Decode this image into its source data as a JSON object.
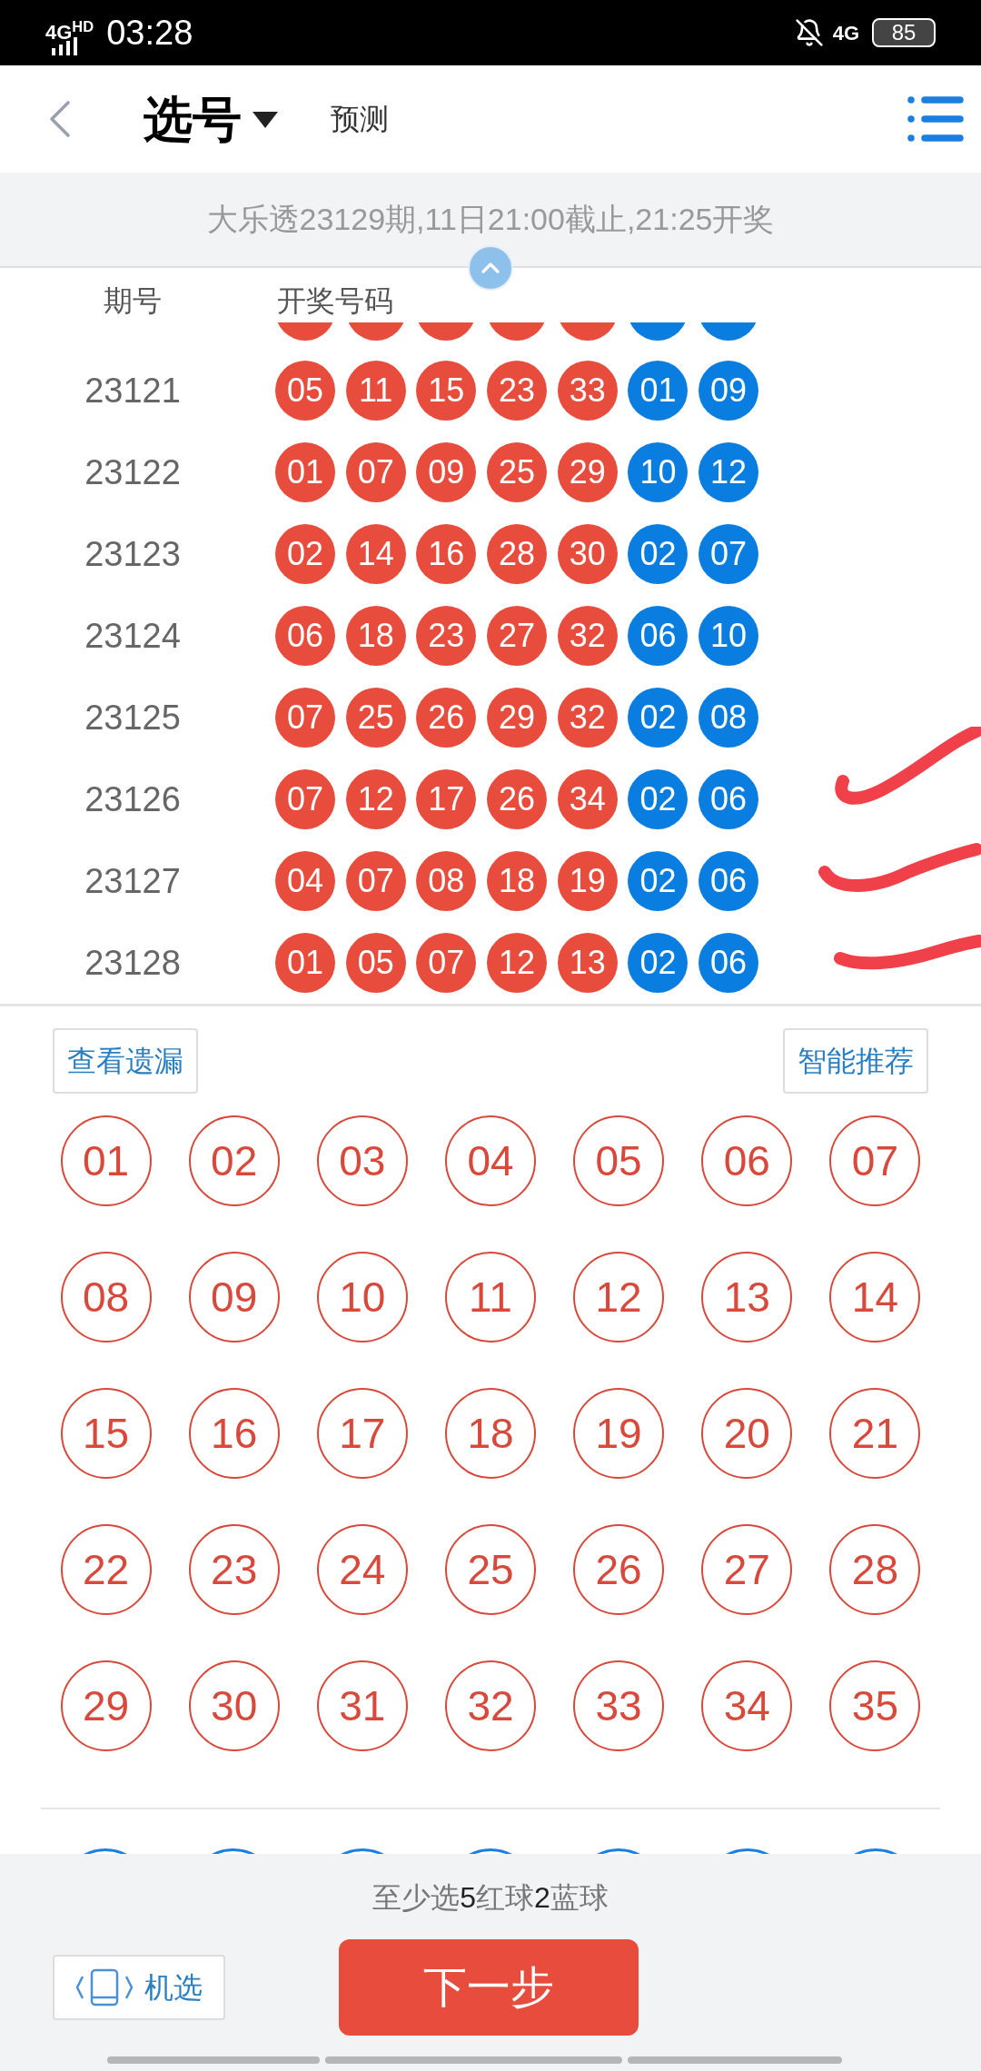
{
  "status_bar": {
    "network": "4G$^{HD}$",
    "time": "03:28",
    "mobile_data": "4G",
    "battery": "85"
  },
  "header": {
    "title": "选号",
    "tab": "预测"
  },
  "info_bar": {
    "text": "大乐透23129期,11日21:00截止,21:25开奖"
  },
  "history": {
    "columns": [
      "期号",
      "开奖号码"
    ],
    "cut_row": [
      {
        "kind": "red"
      },
      {
        "kind": "red"
      },
      {
        "kind": "red"
      },
      {
        "kind": "red"
      },
      {
        "kind": "red"
      },
      {
        "kind": "blue"
      },
      {
        "kind": "blue"
      }
    ],
    "rows": [
      {
        "issue": "23121",
        "balls": [
          {
            "number": "05",
            "kind": "red"
          },
          {
            "number": "11",
            "kind": "red"
          },
          {
            "number": "15",
            "kind": "red"
          },
          {
            "number": "23",
            "kind": "red"
          },
          {
            "number": "33",
            "kind": "red"
          },
          {
            "number": "01",
            "kind": "blue"
          },
          {
            "number": "09",
            "kind": "blue"
          }
        ]
      },
      {
        "issue": "23122",
        "balls": [
          {
            "number": "01",
            "kind": "red"
          },
          {
            "number": "07",
            "kind": "red"
          },
          {
            "number": "09",
            "kind": "red"
          },
          {
            "number": "25",
            "kind": "red"
          },
          {
            "number": "29",
            "kind": "red"
          },
          {
            "number": "10",
            "kind": "blue"
          },
          {
            "number": "12",
            "kind": "blue"
          }
        ]
      },
      {
        "issue": "23123",
        "balls": [
          {
            "number": "02",
            "kind": "red"
          },
          {
            "number": "14",
            "kind": "red"
          },
          {
            "number": "16",
            "kind": "red"
          },
          {
            "number": "28",
            "kind": "red"
          },
          {
            "number": "30",
            "kind": "red"
          },
          {
            "number": "02",
            "kind": "blue"
          },
          {
            "number": "07",
            "kind": "blue"
          }
        ]
      },
      {
        "issue": "23124",
        "balls": [
          {
            "number": "06",
            "kind": "red"
          },
          {
            "number": "18",
            "kind": "red"
          },
          {
            "number": "23",
            "kind": "red"
          },
          {
            "number": "27",
            "kind": "red"
          },
          {
            "number": "32",
            "kind": "red"
          },
          {
            "number": "06",
            "kind": "blue"
          },
          {
            "number": "10",
            "kind": "blue"
          }
        ]
      },
      {
        "issue": "23125",
        "balls": [
          {
            "number": "07",
            "kind": "red"
          },
          {
            "number": "25",
            "kind": "red"
          },
          {
            "number": "26",
            "kind": "red"
          },
          {
            "number": "29",
            "kind": "red"
          },
          {
            "number": "32",
            "kind": "red"
          },
          {
            "number": "02",
            "kind": "blue"
          },
          {
            "number": "08",
            "kind": "blue"
          }
        ]
      },
      {
        "issue": "23126",
        "balls": [
          {
            "number": "07",
            "kind": "red"
          },
          {
            "number": "12",
            "kind": "red"
          },
          {
            "number": "17",
            "kind": "red"
          },
          {
            "number": "26",
            "kind": "red"
          },
          {
            "number": "34",
            "kind": "red"
          },
          {
            "number": "02",
            "kind": "blue"
          },
          {
            "number": "06",
            "kind": "blue"
          }
        ]
      },
      {
        "issue": "23127",
        "balls": [
          {
            "number": "04",
            "kind": "red"
          },
          {
            "number": "07",
            "kind": "red"
          },
          {
            "number": "08",
            "kind": "red"
          },
          {
            "number": "18",
            "kind": "red"
          },
          {
            "number": "19",
            "kind": "red"
          },
          {
            "number": "02",
            "kind": "blue"
          },
          {
            "number": "06",
            "kind": "blue"
          }
        ]
      },
      {
        "issue": "23128",
        "balls": [
          {
            "number": "01",
            "kind": "red"
          },
          {
            "number": "05",
            "kind": "red"
          },
          {
            "number": "07",
            "kind": "red"
          },
          {
            "number": "12",
            "kind": "red"
          },
          {
            "number": "13",
            "kind": "red"
          },
          {
            "number": "02",
            "kind": "blue"
          },
          {
            "number": "06",
            "kind": "blue"
          }
        ]
      }
    ]
  },
  "actions": [
    "查看遗漏",
    "智能推荐"
  ],
  "red_balls": [
    {
      "number": "01",
      "selected": false
    },
    {
      "number": "02",
      "selected": false
    },
    {
      "number": "03",
      "selected": false
    },
    {
      "number": "04",
      "selected": false
    },
    {
      "number": "05",
      "selected": false
    },
    {
      "number": "06",
      "selected": false
    },
    {
      "number": "07",
      "selected": false
    },
    {
      "number": "08",
      "selected": false
    },
    {
      "number": "09",
      "selected": false
    },
    {
      "number": "10",
      "selected": false
    },
    {
      "number": "11",
      "selected": false
    },
    {
      "number": "12",
      "selected": false
    },
    {
      "number": "13",
      "selected": false
    },
    {
      "number": "14",
      "selected": false
    },
    {
      "number": "15",
      "selected": false
    },
    {
      "number": "16",
      "selected": false
    },
    {
      "number": "17",
      "selected": false
    },
    {
      "number": "18",
      "selected": false
    },
    {
      "number": "19",
      "selected": false
    },
    {
      "number": "20",
      "selected": false
    },
    {
      "number": "21",
      "selected": false
    },
    {
      "number": "22",
      "selected": false
    },
    {
      "number": "23",
      "selected": false
    },
    {
      "number": "24",
      "selected": false
    },
    {
      "number": "25",
      "selected": false
    },
    {
      "number": "26",
      "selected": false
    },
    {
      "number": "27",
      "selected": false
    },
    {
      "number": "28",
      "selected": false
    },
    {
      "number": "29",
      "selected": false
    },
    {
      "number": "30",
      "selected": false
    },
    {
      "number": "31",
      "selected": false
    },
    {
      "number": "32",
      "selected": false
    },
    {
      "number": "33",
      "selected": false
    },
    {
      "number": "34",
      "selected": false
    },
    {
      "number": "35",
      "selected": false
    }
  ],
  "blue_balls_cut": [
    {
      "selected": false
    },
    {
      "selected": false
    },
    {
      "selected": false
    },
    {
      "selected": false
    },
    {
      "selected": false
    },
    {
      "selected": false
    },
    {
      "selected": false
    }
  ],
  "footer": {
    "hint": "至少选**5**红球**2**蓝球",
    "random_button": "机选",
    "next_button": "下一步"
  }
}
